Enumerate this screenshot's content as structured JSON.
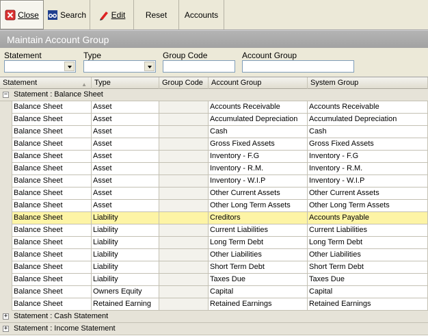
{
  "toolbar": {
    "close": "Close",
    "search": "Search",
    "edit": "Edit",
    "reset": "Reset",
    "accounts": "Accounts"
  },
  "title": "Maintain Account Group",
  "filters": {
    "statement_label": "Statement",
    "type_label": "Type",
    "group_code_label": "Group Code",
    "account_group_label": "Account Group"
  },
  "columns": [
    "Statement",
    "Type",
    "Group Code",
    "Account Group",
    "System Group"
  ],
  "groups": [
    {
      "label": "Statement : Balance Sheet",
      "expander": "−"
    },
    {
      "label": "Statement : Cash Statement",
      "expander": "+"
    },
    {
      "label": "Statement : Income Statement",
      "expander": "+"
    }
  ],
  "rows": [
    {
      "statement": "Balance Sheet",
      "type": "Asset",
      "group_code": "",
      "account_group": "Accounts Receivable",
      "system_group": "Accounts Receivable"
    },
    {
      "statement": "Balance Sheet",
      "type": "Asset",
      "group_code": "",
      "account_group": "Accumulated Depreciation",
      "system_group": "Accumulated Depreciation"
    },
    {
      "statement": "Balance Sheet",
      "type": "Asset",
      "group_code": "",
      "account_group": "Cash",
      "system_group": "Cash"
    },
    {
      "statement": "Balance Sheet",
      "type": "Asset",
      "group_code": "",
      "account_group": "Gross Fixed Assets",
      "system_group": "Gross Fixed Assets"
    },
    {
      "statement": "Balance Sheet",
      "type": "Asset",
      "group_code": "",
      "account_group": "Inventory - F.G",
      "system_group": "Inventory - F.G"
    },
    {
      "statement": "Balance Sheet",
      "type": "Asset",
      "group_code": "",
      "account_group": "Inventory - R.M.",
      "system_group": "Inventory - R.M."
    },
    {
      "statement": "Balance Sheet",
      "type": "Asset",
      "group_code": "",
      "account_group": "Inventory - W.I.P",
      "system_group": "Inventory - W.I.P"
    },
    {
      "statement": "Balance Sheet",
      "type": "Asset",
      "group_code": "",
      "account_group": "Other Current Assets",
      "system_group": "Other Current Assets"
    },
    {
      "statement": "Balance Sheet",
      "type": "Asset",
      "group_code": "",
      "account_group": "Other Long Term Assets",
      "system_group": "Other Long Term Assets"
    },
    {
      "statement": "Balance Sheet",
      "type": "Liability",
      "group_code": "",
      "account_group": "Creditors",
      "system_group": "Accounts Payable"
    },
    {
      "statement": "Balance Sheet",
      "type": "Liability",
      "group_code": "",
      "account_group": "Current Liabilities",
      "system_group": "Current Liabilities"
    },
    {
      "statement": "Balance Sheet",
      "type": "Liability",
      "group_code": "",
      "account_group": "Long Term Debt",
      "system_group": "Long Term Debt"
    },
    {
      "statement": "Balance Sheet",
      "type": "Liability",
      "group_code": "",
      "account_group": "Other Liabilities",
      "system_group": "Other Liabilities"
    },
    {
      "statement": "Balance Sheet",
      "type": "Liability",
      "group_code": "",
      "account_group": "Short Term Debt",
      "system_group": "Short Term Debt"
    },
    {
      "statement": "Balance Sheet",
      "type": "Liability",
      "group_code": "",
      "account_group": "Taxes Due",
      "system_group": "Taxes Due"
    },
    {
      "statement": "Balance Sheet",
      "type": "Owners Equity",
      "group_code": "",
      "account_group": "Capital",
      "system_group": "Capital"
    },
    {
      "statement": "Balance Sheet",
      "type": "Retained Earning",
      "group_code": "",
      "account_group": "Retained Earnings",
      "system_group": "Retained Earnings"
    }
  ],
  "selected_row": 9,
  "colors": {
    "selection": "#fdf4a5",
    "title_bar": "#a8a8a8"
  }
}
